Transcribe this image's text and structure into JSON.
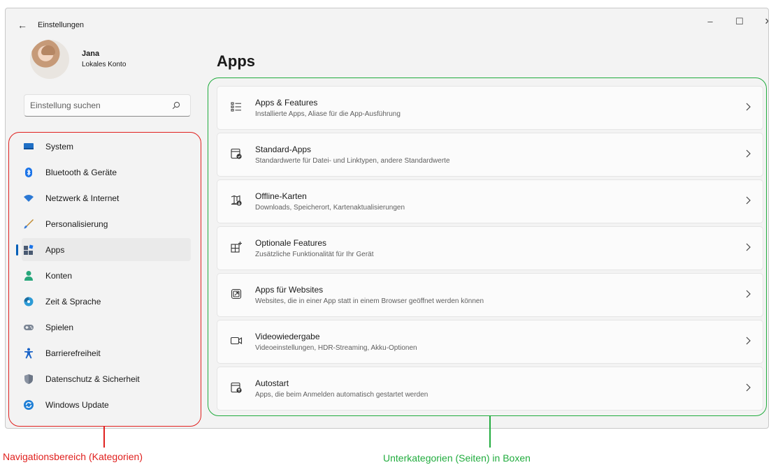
{
  "window": {
    "title": "Einstellungen",
    "back_icon": "arrow-left-icon",
    "controls": {
      "minimize": "–",
      "maximize": "☐",
      "close": "✕"
    }
  },
  "profile": {
    "name": "Jana",
    "account_type": "Lokales Konto"
  },
  "search": {
    "placeholder": "Einstellung suchen"
  },
  "nav": {
    "items": [
      {
        "label": "System",
        "icon": "monitor-icon",
        "color": "#1f6fc5"
      },
      {
        "label": "Bluetooth & Geräte",
        "icon": "bluetooth-icon",
        "color": "#1a73e8"
      },
      {
        "label": "Netzwerk & Internet",
        "icon": "wifi-icon",
        "color": "#2b78d4"
      },
      {
        "label": "Personalisierung",
        "icon": "brush-icon",
        "color": "#c0892f"
      },
      {
        "label": "Apps",
        "icon": "apps-icon",
        "color": "#4a5a72",
        "active": true
      },
      {
        "label": "Konten",
        "icon": "person-icon",
        "color": "#26a67a"
      },
      {
        "label": "Zeit & Sprache",
        "icon": "globe-clock-icon",
        "color": "#2d9bd6"
      },
      {
        "label": "Spielen",
        "icon": "gamepad-icon",
        "color": "#7b8594"
      },
      {
        "label": "Barrierefreiheit",
        "icon": "accessibility-icon",
        "color": "#1a63c7"
      },
      {
        "label": "Datenschutz & Sicherheit",
        "icon": "shield-icon",
        "color": "#6c7686"
      },
      {
        "label": "Windows Update",
        "icon": "update-icon",
        "color": "#1f7fd6"
      }
    ]
  },
  "main": {
    "title": "Apps",
    "cards": [
      {
        "title": "Apps & Features",
        "subtitle": "Installierte Apps, Aliase für die App-Ausführung",
        "icon": "list-icon"
      },
      {
        "title": "Standard-Apps",
        "subtitle": "Standardwerte für Datei- und Linktypen, andere Standardwerte",
        "icon": "default-apps-icon"
      },
      {
        "title": "Offline-Karten",
        "subtitle": "Downloads, Speicherort, Kartenaktualisierungen",
        "icon": "map-download-icon"
      },
      {
        "title": "Optionale Features",
        "subtitle": "Zusätzliche Funktionalität für Ihr Gerät",
        "icon": "grid-add-icon"
      },
      {
        "title": "Apps für Websites",
        "subtitle": "Websites, die in einer App statt in einem Browser geöffnet werden können",
        "icon": "open-external-icon"
      },
      {
        "title": "Videowiedergabe",
        "subtitle": "Videoeinstellungen, HDR-Streaming, Akku-Optionen",
        "icon": "video-icon"
      },
      {
        "title": "Autostart",
        "subtitle": "Apps, die beim Anmelden automatisch gestartet werden",
        "icon": "startup-icon"
      }
    ]
  },
  "annotations": {
    "nav_caption": "Navigationsbereich (Kategorien)",
    "main_caption": "Unterkategorien (Seiten) in Boxen",
    "nav_color": "#e0201e",
    "main_color": "#21ac3e"
  }
}
